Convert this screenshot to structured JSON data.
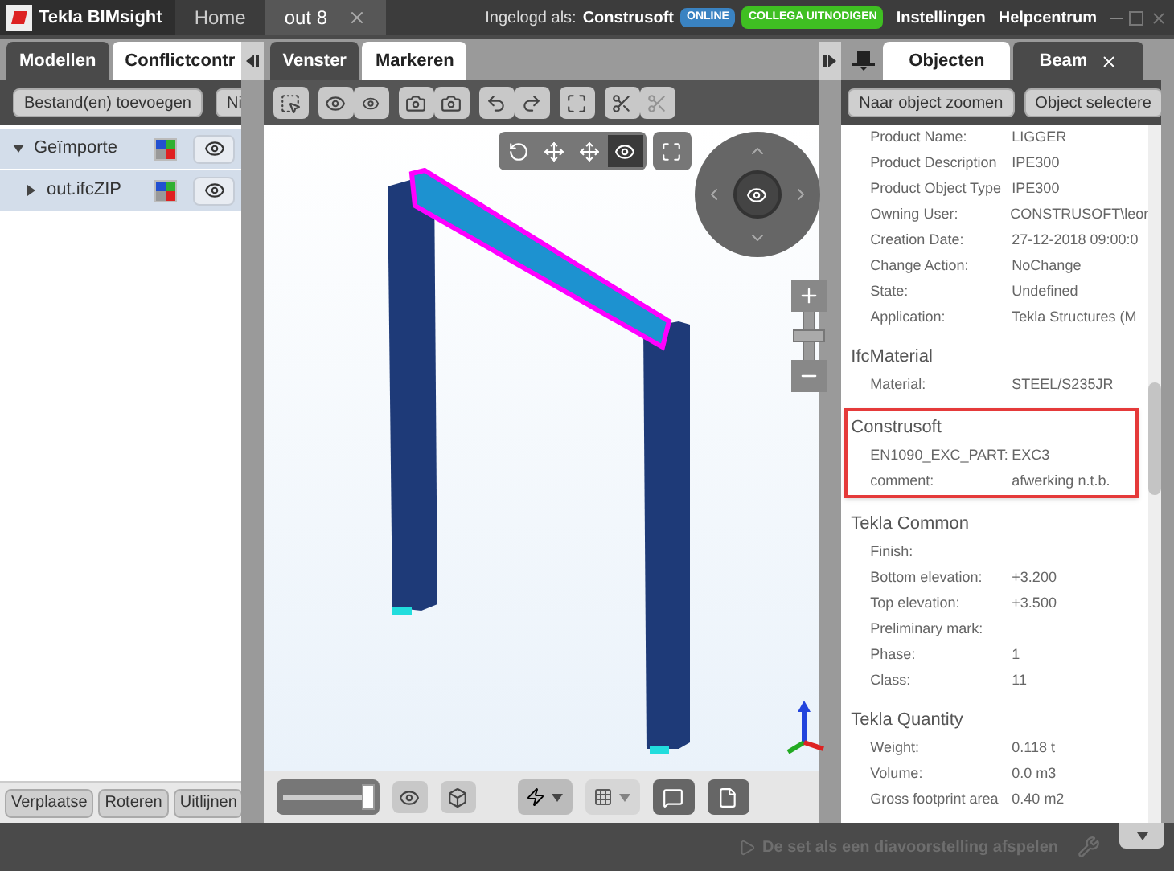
{
  "title_bar": {
    "app_name": "Tekla BIMsight",
    "tabs": [
      {
        "label": "Home",
        "selected": false
      },
      {
        "label": "out 8",
        "selected": true
      }
    ],
    "login_label": "Ingelogd als:",
    "user": "Construsoft",
    "status_badge": "ONLINE",
    "invite_button": "COLLEGA UITNODIGEN",
    "links": [
      "Instellingen",
      "Helpcentrum"
    ]
  },
  "left_panel": {
    "tabs": [
      {
        "label": "Modellen",
        "selected": true
      },
      {
        "label": "Conflictcontr",
        "selected": false
      }
    ],
    "toolbar_buttons": [
      "Bestand(en) toevoegen",
      "Ni"
    ],
    "tree": [
      {
        "label": "Geïmporte",
        "expanded": true,
        "children": [
          {
            "label": "out.ifcZIP",
            "expanded": false
          }
        ]
      }
    ],
    "bottom_buttons": [
      "Verplaatse",
      "Roteren",
      "Uitlijnen"
    ]
  },
  "center_panel": {
    "tabs": [
      {
        "label": "Venster",
        "selected": true
      },
      {
        "label": "Markeren",
        "selected": false
      }
    ],
    "nav_modes": [
      {
        "kind": "rotate",
        "selected": false
      },
      {
        "kind": "pan",
        "selected": false
      },
      {
        "kind": "move",
        "selected": false
      },
      {
        "kind": "look",
        "selected": true
      }
    ],
    "transparency_slider": {
      "level": 0.95
    },
    "zoom_slider": {
      "level": 0.5
    }
  },
  "right_panel": {
    "tabs": [
      {
        "label": "Objecten",
        "selected": false
      },
      {
        "label": "Beam",
        "selected": true
      }
    ],
    "buttons": [
      "Naar object zoomen",
      "Object selectere"
    ],
    "sections": [
      {
        "highlighted": false,
        "rows": [
          {
            "label": "Product Name:",
            "value": "LIGGER"
          },
          {
            "label": "Product Description",
            "value": "IPE300"
          },
          {
            "label": "Product Object Type",
            "value": "IPE300"
          },
          {
            "label": "Owning User:",
            "value": "CONSTRUSOFT\\leor"
          },
          {
            "label": "Creation Date:",
            "value": "27-12-2018 09:00:0"
          },
          {
            "label": "Change Action:",
            "value": "NoChange"
          },
          {
            "label": "State:",
            "value": "Undefined"
          },
          {
            "label": "Application:",
            "value": "Tekla Structures (M"
          }
        ]
      },
      {
        "title": "IfcMaterial",
        "highlighted": false,
        "rows": [
          {
            "label": "Material:",
            "value": "STEEL/S235JR"
          }
        ]
      },
      {
        "title": "Construsoft",
        "highlighted": true,
        "rows": [
          {
            "label": "EN1090_EXC_PART:",
            "value": "EXC3"
          },
          {
            "label": "comment:",
            "value": "afwerking n.t.b."
          }
        ]
      },
      {
        "title": "Tekla Common",
        "highlighted": false,
        "rows": [
          {
            "label": "Finish:"
          },
          {
            "label": "Bottom elevation:",
            "value": "+3.200"
          },
          {
            "label": "Top elevation:",
            "value": "+3.500"
          },
          {
            "label": "Preliminary mark:"
          },
          {
            "label": "Phase:",
            "value": "1"
          },
          {
            "label": "Class:",
            "value": "11"
          }
        ]
      },
      {
        "title": "Tekla Quantity",
        "highlighted": false,
        "rows": [
          {
            "label": "Weight:",
            "value": "0.118 t"
          },
          {
            "label": "Volume:",
            "value": "0.0 m3"
          },
          {
            "label": "Gross footprint area",
            "value": "0.40 m2"
          }
        ]
      }
    ]
  },
  "status_bar": {
    "slideshow_button": {
      "label": "De set als een diavoorstelling afspelen",
      "disabled": true
    }
  }
}
